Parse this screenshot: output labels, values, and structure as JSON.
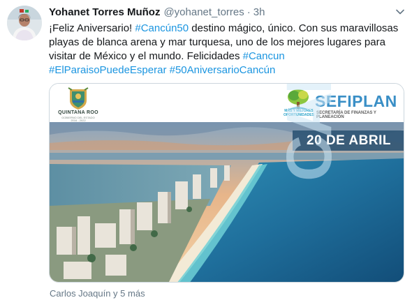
{
  "tweet": {
    "author_name": "Yohanet Torres Muñoz",
    "author_handle": "@yohanet_torres",
    "separator": "·",
    "time": "3h",
    "text_intro": "¡Feliz Aniversario! ",
    "hashtag_cancun50": "#Cancún50",
    "text_body": " destino mágico, único. Con sus maravillosas playas de blanca arena y mar turquesa, uno de los mejores lugares para visitar de México y el mundo. Felicidades ",
    "hashtag_cancun": "#Cancun",
    "hashtag_paraiso": "#ElParaisoPuedeEsperar",
    "hashtag_aniversario": "#50AniversarioCancún",
    "liked_by": "Carlos Joaquín y 5 más"
  },
  "media": {
    "left_logo_name": "QUINTANA ROO",
    "left_logo_sub": "GOBIERNO DEL ESTADO",
    "left_logo_years": "2016 - 2022",
    "sefiplan_name": "SEFIPLAN",
    "sefiplan_sub": "SECRETARÍA DE FINANZAS Y PLANEACIÓN",
    "sefiplan_slogan": "MÁS Y MEJORES OPORTUNIDADES",
    "date_label": "20 DE ABRIL",
    "overlay_text": "CAN50"
  },
  "icons": {
    "avatar": "avatar",
    "caret": "chevron-down-icon"
  },
  "colors": {
    "link": "#1b95e0",
    "muted": "#657786",
    "date_banner": "#2f5676"
  }
}
